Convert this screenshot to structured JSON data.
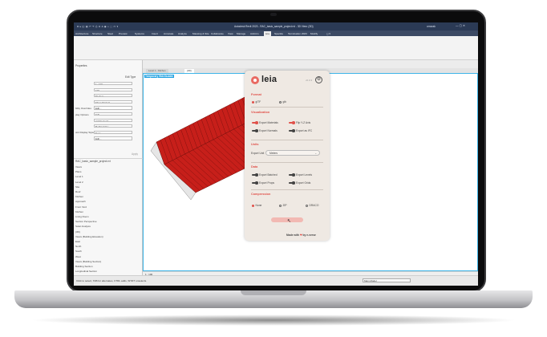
{
  "app": {
    "title": "Autodesk Revit 2023 - RAC_basic_sample_project.rvt - 3D View: {3D}",
    "user": "ornorak",
    "quick_access": "R ▸ ◫ ▤ ↶ ↷ ⎙ ⊡ A ◉ ⌂ ⬚ ▭ ▾"
  },
  "menu": {
    "items": [
      "Architecture",
      "Structure",
      "Steel",
      "Precast",
      "Systems",
      "Insert",
      "Annotate",
      "Analyze",
      "Massing & Site",
      "Collaborate",
      "View",
      "Manage",
      "Add-Ins",
      "leia",
      "Speckle",
      "Termination 2023",
      "Modify",
      "◻ ▾"
    ],
    "active": "leia"
  },
  "left_panel": {
    "header": "Properties",
    "edit_type": "Edit Type",
    "fields": [
      {
        "label": "",
        "value": "1 : 100"
      },
      {
        "label": "",
        "value": "100"
      },
      {
        "label": "",
        "value": "Medium"
      },
      {
        "label": "",
        "value": "Show Original"
      },
      {
        "label": "bility Overrides",
        "value": "Edit..."
      },
      {
        "label": "play Options",
        "value": "Edit..."
      },
      {
        "label": "",
        "value": "Architectural"
      },
      {
        "label": "",
        "value": "By Discipline"
      },
      {
        "label": "oint Display Style",
        "value": "None"
      },
      {
        "label": "",
        "value": "Edit..."
      }
    ],
    "apply": "Apply",
    "browser_header": "RAC_basic_sample_project.rvt",
    "tree": [
      "Views",
      "Plans",
      "Level 1",
      "Level 2",
      "Site",
      "Roof",
      "Kitchen",
      "Approach",
      "Front Yard",
      "Kitchen",
      "Living Room",
      "Section Perspective",
      "Solar Analysis",
      "{3D}",
      "Views (Building Elevation)",
      "East",
      "North",
      "South",
      "West",
      "Views (Building Section)",
      "Building Section",
      "Longitudinal Section",
      "Wall Section"
    ]
  },
  "view_tabs": [
    {
      "label": "Level 1 - Kitchen",
      "active": false
    },
    {
      "label": "{3D}",
      "active": true
    }
  ],
  "view": {
    "temporary_label": "Temporary Hide/Isolate",
    "scale": "1 : 100",
    "roof_color": "#c71f1a"
  },
  "status": {
    "hint": "Click to select, TAB for alternates, CTRL adds, SHIFT unselects.",
    "model": "Main Model"
  },
  "leia": {
    "brand": "leia",
    "version": "v0.0.3",
    "format": {
      "title": "Format",
      "options": [
        {
          "label": "glTF",
          "selected": true
        },
        {
          "label": "glb",
          "selected": false
        }
      ]
    },
    "visualization": {
      "title": "Visualization",
      "options": [
        {
          "label": "Export Materials",
          "on": true
        },
        {
          "label": "Flip Y-Z Axis",
          "on": true
        },
        {
          "label": "Export Normals",
          "on": false
        },
        {
          "label": "Export as IFC",
          "on": false
        }
      ]
    },
    "units": {
      "title": "Units",
      "label": "Export Unit",
      "value": "Meters"
    },
    "data": {
      "title": "Data",
      "options": [
        {
          "label": "Export Batched",
          "on": false
        },
        {
          "label": "Export Levels",
          "on": false
        },
        {
          "label": "Export Props",
          "on": false
        },
        {
          "label": "Export Grids",
          "on": false
        }
      ]
    },
    "compression": {
      "title": "Compression",
      "options": [
        {
          "label": "None",
          "selected": true
        },
        {
          "label": "ZIP",
          "selected": false
        },
        {
          "label": "DRACO",
          "selected": false
        }
      ]
    },
    "footer": {
      "made_with": "Made with",
      "by": "by e-verse"
    },
    "accent": "#e0514a"
  }
}
